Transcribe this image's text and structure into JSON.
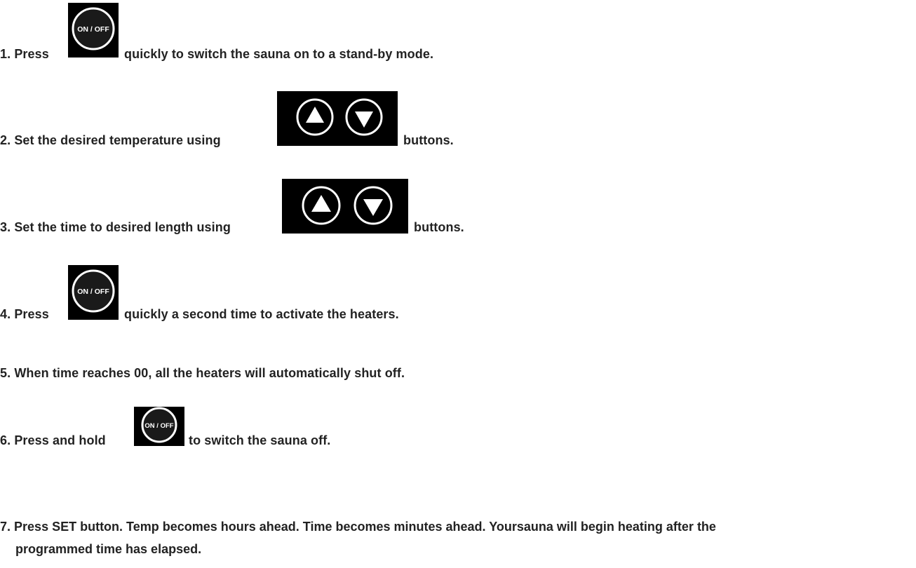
{
  "steps": [
    {
      "number": "1.",
      "before": "Press",
      "after": "quickly to switch the sauna on to a stand-by mode.",
      "icon": "on-off-button-icon"
    },
    {
      "number": "2.",
      "before": "Set the desired temperature using",
      "after": "buttons.",
      "icon": "up-down-arrow-buttons-icon"
    },
    {
      "number": "3.",
      "before": "Set the time to desired length using",
      "after": "buttons.",
      "icon": "up-down-arrow-buttons-icon"
    },
    {
      "number": "4.",
      "before": "Press",
      "after": "quickly a second time to activate the heaters.",
      "icon": "on-off-button-icon"
    },
    {
      "number": "5.",
      "text": "When time reaches 00, all the heaters will automatically shut off."
    },
    {
      "number": "6.",
      "before": "Press and hold",
      "after": "to switch the sauna off.",
      "icon": "on-off-button-icon"
    },
    {
      "number": "7.",
      "line1": "Press SET button. Temp becomes hours ahead. Time becomes minutes ahead. Yoursauna will begin heating after the",
      "line2": "programmed time has elapsed."
    }
  ],
  "icon_label": "ON / OFF",
  "colors": {
    "text": "#222222",
    "icon_bg": "#000000",
    "icon_ring": "#ffffff"
  }
}
